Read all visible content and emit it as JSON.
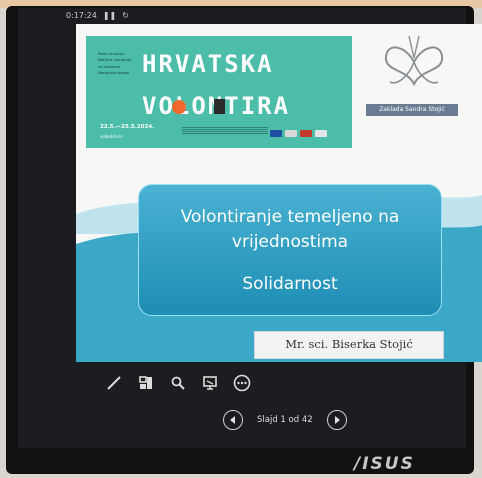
{
  "player": {
    "timer": "0:17:24",
    "pause_icon": "pause-icon",
    "reset_icon": "reset-icon",
    "slide_counter": "Slajd 1 od 42",
    "tools": [
      "pen-icon",
      "slides-icon",
      "zoom-icon",
      "screen-icon",
      "more-icon"
    ],
    "nav": [
      "previous-icon",
      "next-icon"
    ]
  },
  "slide": {
    "banner": {
      "title_line1": "HRVATSKA",
      "title_line2": "VOLONTIRA",
      "dates": "22.5.—25.5.2024.",
      "website": "volontira.hr",
      "small_text": [
        "Poziv na akciju",
        "Matično udruženje",
        "za volontere",
        "Nacionalni tjedan"
      ]
    },
    "zaklada": {
      "name": "Zaklada Sandra Stojić"
    },
    "heading": {
      "line1": "Volontiranje temeljeno na",
      "line2": "vrijednostima",
      "line3": "Solidarnost"
    },
    "author": "Mr. sci. Biserka Stojić"
  },
  "device": {
    "brand": "/ISUS"
  },
  "colors": {
    "banner": "#4bbda8",
    "panel": "#2f9dc4",
    "wave": "#3aa8c6",
    "accent_orange": "#f0682e"
  }
}
